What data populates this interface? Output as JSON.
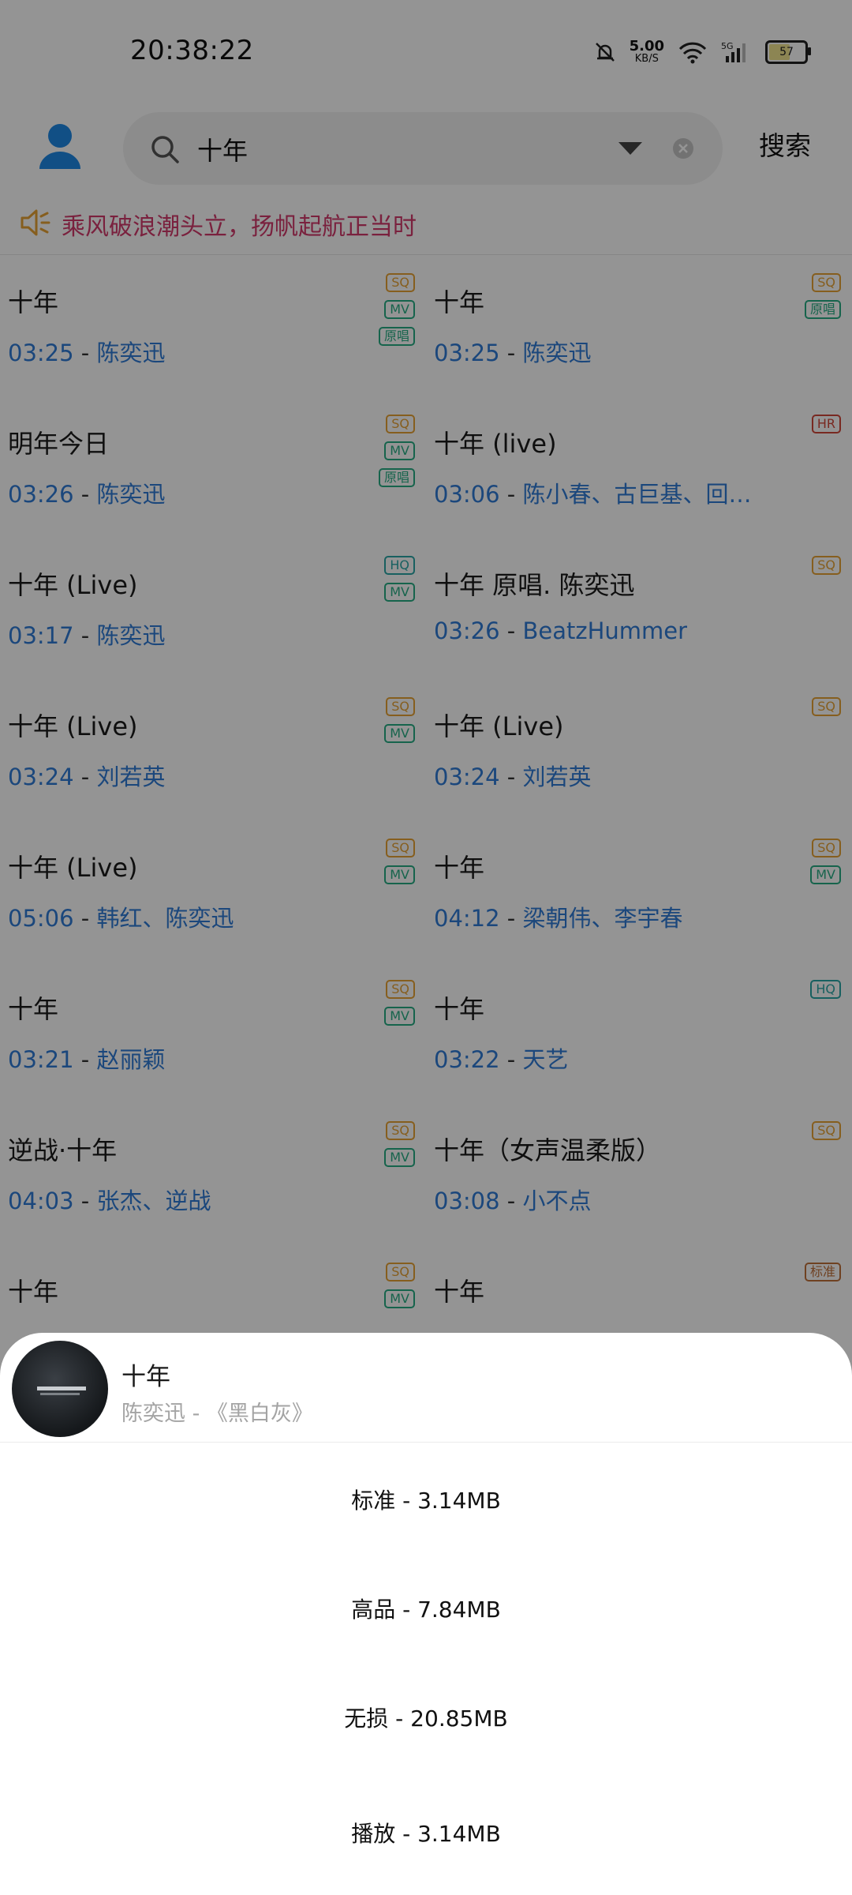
{
  "status": {
    "time": "20:38:22",
    "net_speed": "5.00",
    "net_unit": "KB/S",
    "battery": "57"
  },
  "search": {
    "query": "十年",
    "button_label": "搜索"
  },
  "announcement": "乘风破浪潮头立，扬帆起航正当时",
  "songs": [
    {
      "title": "十年",
      "duration": "03:25",
      "artist": "陈奕迅",
      "badges": [
        "SQ",
        "MV",
        "原唱"
      ]
    },
    {
      "title": "十年",
      "duration": "03:25",
      "artist": "陈奕迅",
      "badges": [
        "SQ",
        "原唱"
      ]
    },
    {
      "title": "明年今日",
      "duration": "03:26",
      "artist": "陈奕迅",
      "badges": [
        "SQ",
        "MV",
        "原唱"
      ]
    },
    {
      "title": "十年 (live)",
      "duration": "03:06",
      "artist": "陈小春、古巨基、回…",
      "badges": [
        "HR"
      ]
    },
    {
      "title": "十年 (Live)",
      "duration": "03:17",
      "artist": "陈奕迅",
      "badges": [
        "HQ",
        "MV"
      ]
    },
    {
      "title": "十年 原唱. 陈奕迅",
      "duration": "03:26",
      "artist": "BeatzHummer",
      "badges": [
        "SQ"
      ]
    },
    {
      "title": "十年 (Live)",
      "duration": "03:24",
      "artist": "刘若英",
      "badges": [
        "SQ",
        "MV"
      ]
    },
    {
      "title": "十年 (Live)",
      "duration": "03:24",
      "artist": "刘若英",
      "badges": [
        "SQ"
      ]
    },
    {
      "title": "十年 (Live)",
      "duration": "05:06",
      "artist": "韩红、陈奕迅",
      "badges": [
        "SQ",
        "MV"
      ]
    },
    {
      "title": "十年",
      "duration": "04:12",
      "artist": "梁朝伟、李宇春",
      "badges": [
        "SQ",
        "MV"
      ]
    },
    {
      "title": "十年",
      "duration": "03:21",
      "artist": "赵丽颖",
      "badges": [
        "SQ",
        "MV"
      ]
    },
    {
      "title": "十年",
      "duration": "03:22",
      "artist": "天艺",
      "badges": [
        "HQ"
      ]
    },
    {
      "title": "逆战·十年",
      "duration": "04:03",
      "artist": "张杰、逆战",
      "badges": [
        "SQ",
        "MV"
      ]
    },
    {
      "title": "十年（女声温柔版）",
      "duration": "03:08",
      "artist": "小不点",
      "badges": [
        "SQ"
      ]
    },
    {
      "title": "十年",
      "duration": "",
      "artist": "",
      "badges": [
        "SQ",
        "MV"
      ]
    },
    {
      "title": "十年",
      "duration": "",
      "artist": "",
      "badges": [
        "标准"
      ]
    }
  ],
  "sheet": {
    "song_title": "十年",
    "song_sub": "陈奕迅 - 《黑白灰》",
    "options": [
      "标准 - 3.14MB",
      "高品 - 7.84MB",
      "无损 - 20.85MB",
      "播放 - 3.14MB"
    ]
  },
  "colors": {
    "accent_blue": "#2f7bd6",
    "announce_pink": "#d23a6b",
    "sq_badge": "#e7a234",
    "mv_badge": "#27ad84",
    "hr_badge": "#d0473a"
  }
}
